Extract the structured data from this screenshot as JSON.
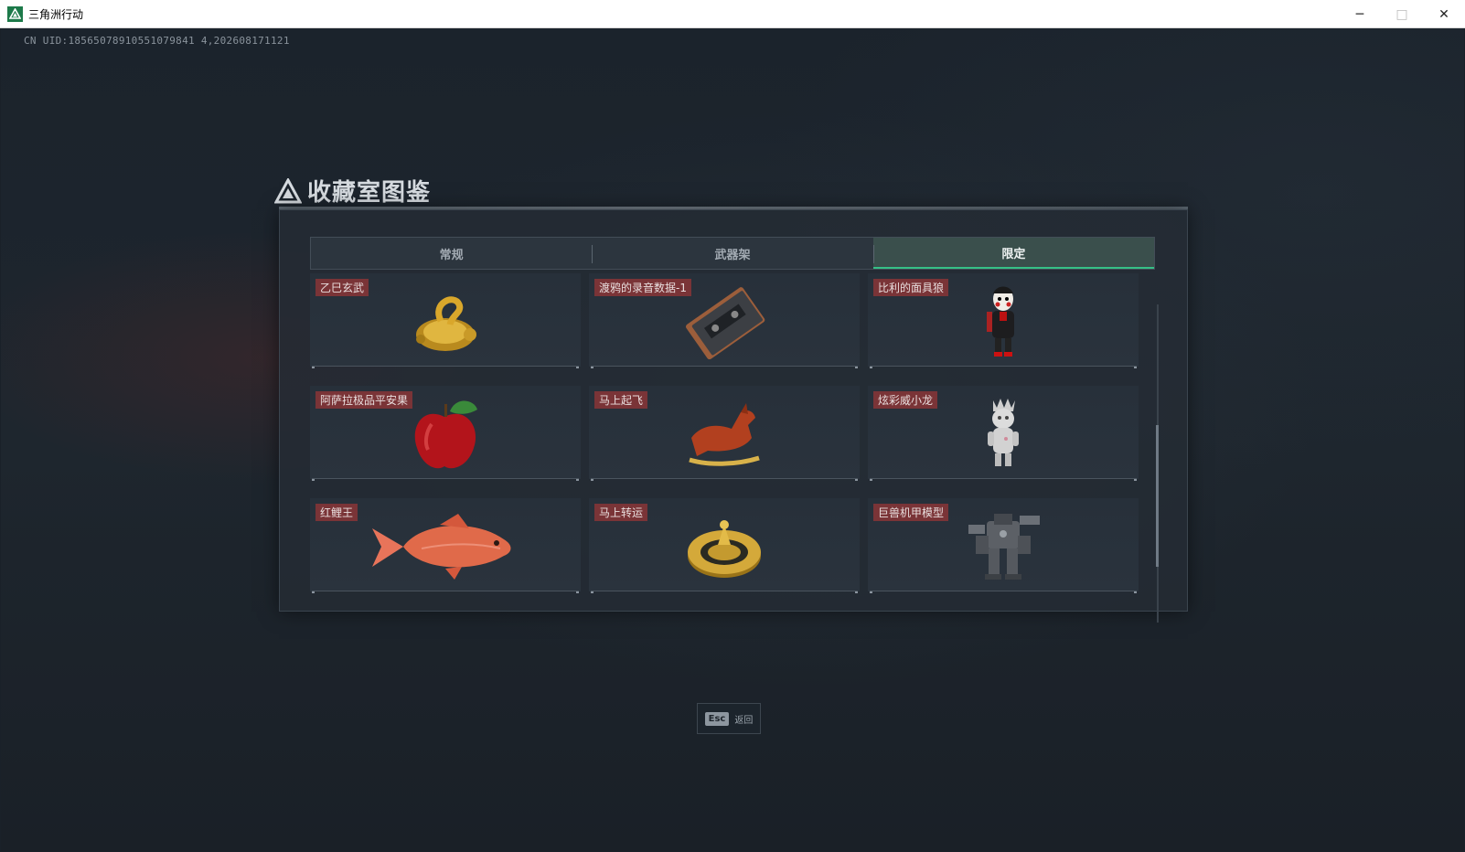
{
  "window": {
    "title": "三角洲行动",
    "controls": {
      "minimize": "─",
      "maximize": "□",
      "close": "✕"
    }
  },
  "uid_text": "CN UID:18565078910551079841 4,202608171121",
  "panel": {
    "title": "收藏室图鉴",
    "tabs": [
      {
        "label": "常规",
        "active": false
      },
      {
        "label": "武器架",
        "active": false
      },
      {
        "label": "限定",
        "active": true
      }
    ],
    "items": [
      {
        "label": "乙巳玄武",
        "icon": "gold-turtle-snake-icon"
      },
      {
        "label": "渡鸦的录音数据-1",
        "icon": "cassette-tape-icon"
      },
      {
        "label": "比利的面具狼",
        "icon": "puppet-doll-icon"
      },
      {
        "label": "阿萨拉极品平安果",
        "icon": "red-apple-icon"
      },
      {
        "label": "马上起飞",
        "icon": "red-horse-icon"
      },
      {
        "label": "炫彩威小龙",
        "icon": "white-dragon-figure-icon"
      },
      {
        "label": "红鲤王",
        "icon": "red-carp-icon"
      },
      {
        "label": "马上转运",
        "icon": "gold-compass-icon"
      },
      {
        "label": "巨兽机甲模型",
        "icon": "mech-model-icon"
      }
    ]
  },
  "esc_hint": {
    "key": "Esc",
    "label": "返回"
  },
  "colors": {
    "accent": "#35c086",
    "label_bg": "#7a3437",
    "active_tab_bg": "#3a4f4c"
  }
}
